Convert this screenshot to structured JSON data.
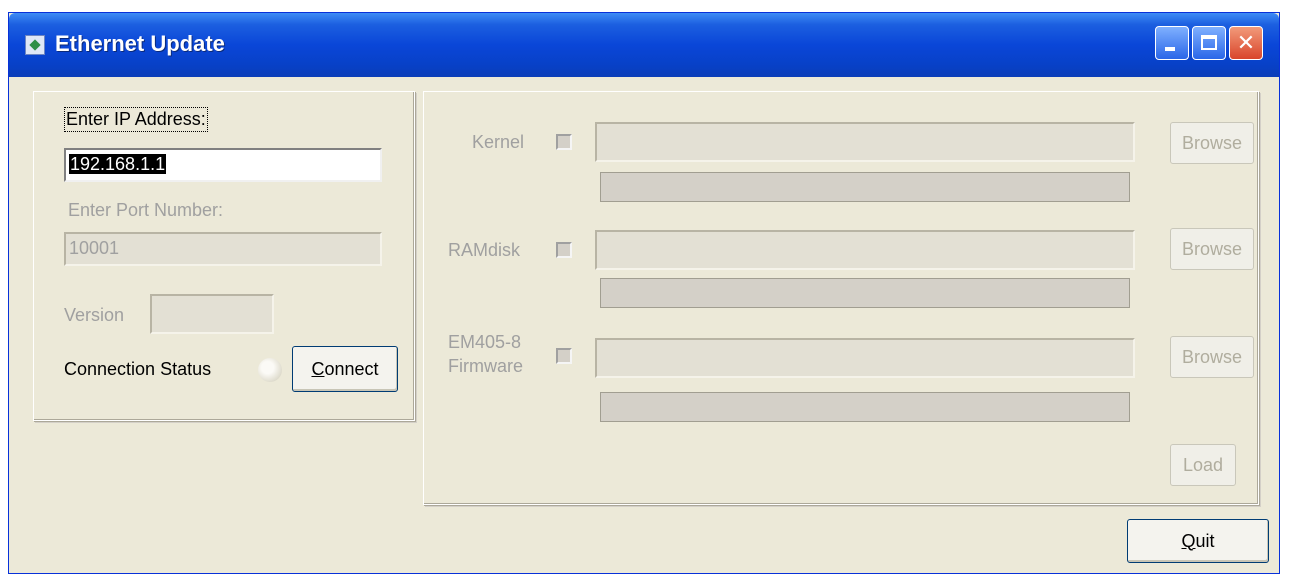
{
  "window": {
    "title": "Ethernet Update"
  },
  "controls": {
    "minimize": "minimize",
    "maximize": "maximize",
    "close": "close"
  },
  "connection": {
    "ip_label": "Enter IP Address:",
    "ip_value": "192.168.1.1",
    "port_label": "Enter Port Number:",
    "port_value": "10001",
    "version_label": "Version",
    "version_value": "",
    "status_label": "Connection Status",
    "connect_button_prefix": "",
    "connect_button_accel": "C",
    "connect_button_rest": "onnect"
  },
  "update": {
    "rows": [
      {
        "label_line1": "Kernel",
        "label_line2": "",
        "path": "",
        "browse": "Browse"
      },
      {
        "label_line1": "RAMdisk",
        "label_line2": "",
        "path": "",
        "browse": "Browse"
      },
      {
        "label_line1": "EM405-8",
        "label_line2": "Firmware",
        "path": "",
        "browse": "Browse"
      }
    ],
    "load_button": "Load"
  },
  "footer": {
    "quit_accel": "Q",
    "quit_rest": "uit"
  },
  "colors": {
    "titlebar": "#0a46d8",
    "face": "#ece9d8",
    "disabled_text": "#a0a0a0"
  }
}
